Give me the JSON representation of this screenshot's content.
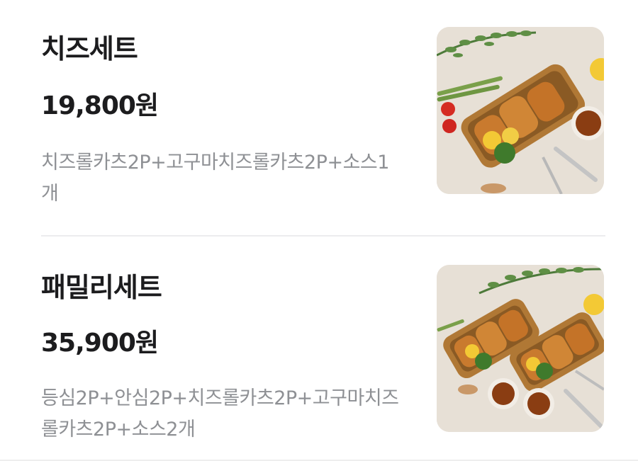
{
  "menu": {
    "items": [
      {
        "name": "치즈세트",
        "price": "19,800원",
        "description": "치즈롤카츠2P+고구마치즈롤카츠2P+소스1개",
        "image": "cheese-cutlet-basket-photo"
      },
      {
        "name": "패밀리세트",
        "price": "35,900원",
        "description": "등심2P+안심2P+치즈롤카츠2P+고구마치즈롤카츠2P+소스2개",
        "image": "family-cutlet-baskets-photo"
      }
    ]
  },
  "colors": {
    "title": "#1c1c1e",
    "description": "#8e9094",
    "divider": "#ececee",
    "photo_background": "#e7e0d6",
    "cutlet": "#c97a2e",
    "basket": "#b07835",
    "lemon": "#f3c935",
    "sauce": "#8a3d12"
  }
}
